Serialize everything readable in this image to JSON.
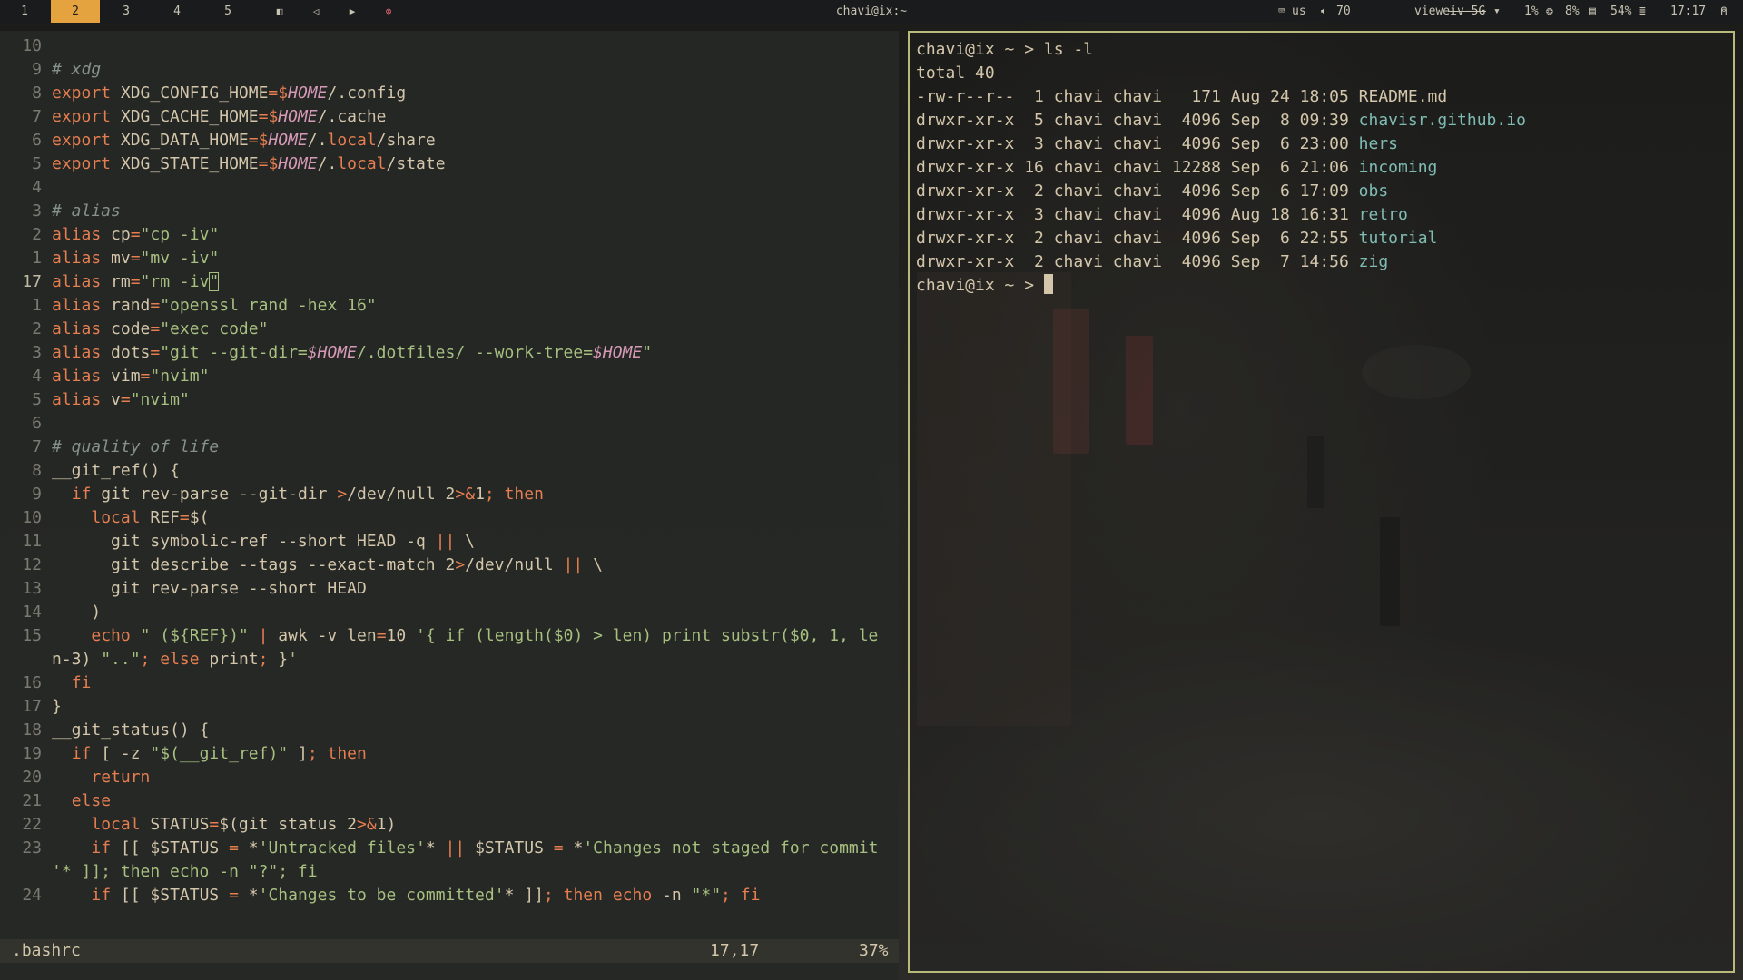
{
  "topbar": {
    "workspaces": [
      "1",
      "2",
      "3",
      "4",
      "5"
    ],
    "active_workspace": "2",
    "controls": [
      "◧",
      "◁",
      "▶",
      "⊗"
    ],
    "window_title": "chavi@ix:~",
    "keyboard_icon": "keyboard-icon",
    "keyboard_layout": "us",
    "volume_icon": "speaker-icon",
    "volume": "70",
    "wifi_name": "vieweiv-5G",
    "cpu": "1%",
    "cpu_icon": "cpu-icon",
    "mem": "8%",
    "mem_icon": "memory-icon",
    "disk": "54%",
    "disk_icon": "disk-icon",
    "clock": "17:17",
    "power_icon": "person-icon"
  },
  "editor": {
    "lines": [
      {
        "n": "10",
        "t": ""
      },
      {
        "n": "9",
        "t": "# xdg"
      },
      {
        "n": "8",
        "t": "export XDG_CONFIG_HOME=$HOME/.config"
      },
      {
        "n": "7",
        "t": "export XDG_CACHE_HOME=$HOME/.cache"
      },
      {
        "n": "6",
        "t": "export XDG_DATA_HOME=$HOME/.local/share"
      },
      {
        "n": "5",
        "t": "export XDG_STATE_HOME=$HOME/.local/state"
      },
      {
        "n": "4",
        "t": ""
      },
      {
        "n": "3",
        "t": "# alias"
      },
      {
        "n": "2",
        "t": "alias cp=\"cp -iv\""
      },
      {
        "n": "1",
        "t": "alias mv=\"mv -iv\""
      },
      {
        "n": "17",
        "t": "alias rm=\"rm -iv\""
      },
      {
        "n": "1",
        "t": "alias rand=\"openssl rand -hex 16\""
      },
      {
        "n": "2",
        "t": "alias code=\"exec code\""
      },
      {
        "n": "3",
        "t": "alias dots=\"git --git-dir=$HOME/.dotfiles/ --work-tree=$HOME\""
      },
      {
        "n": "4",
        "t": "alias vim=\"nvim\""
      },
      {
        "n": "5",
        "t": "alias v=\"nvim\""
      },
      {
        "n": "6",
        "t": ""
      },
      {
        "n": "7",
        "t": "# quality of life"
      },
      {
        "n": "8",
        "t": "__git_ref() {"
      },
      {
        "n": "9",
        "t": "  if git rev-parse --git-dir >/dev/null 2>&1; then"
      },
      {
        "n": "10",
        "t": "    local REF=$("
      },
      {
        "n": "11",
        "t": "      git symbolic-ref --short HEAD -q || \\"
      },
      {
        "n": "12",
        "t": "      git describe --tags --exact-match 2>/dev/null || \\"
      },
      {
        "n": "13",
        "t": "      git rev-parse --short HEAD"
      },
      {
        "n": "14",
        "t": "    )"
      },
      {
        "n": "15",
        "t": "    echo \" (${REF})\" | awk -v len=10 '{ if (length($0) > len) print substr($0, 1, le"
      },
      {
        "n": "",
        "t": "n-3) \"..\"; else print; }'"
      },
      {
        "n": "16",
        "t": "  fi"
      },
      {
        "n": "17",
        "t": "}"
      },
      {
        "n": "18",
        "t": "__git_status() {"
      },
      {
        "n": "19",
        "t": "  if [ -z \"$(__git_ref)\" ]; then"
      },
      {
        "n": "20",
        "t": "    return"
      },
      {
        "n": "21",
        "t": "  else"
      },
      {
        "n": "22",
        "t": "    local STATUS=$(git status 2>&1)"
      },
      {
        "n": "23",
        "t": "    if [[ $STATUS = *'Untracked files'* || $STATUS = *'Changes not staged for commit"
      },
      {
        "n": "",
        "t": "'* ]]; then echo -n \"?\"; fi"
      },
      {
        "n": "24",
        "t": "    if [[ $STATUS = *'Changes to be committed'* ]]; then echo -n \"*\"; fi"
      }
    ],
    "status": {
      "filename": ".bashrc",
      "position": "17,17",
      "percent": "37%"
    }
  },
  "terminal": {
    "prompt": "chavi@ix ~ >",
    "command": "ls -l",
    "total": "total 40",
    "entries": [
      {
        "perm": "-rw-r--r--",
        "links": "1",
        "user": "chavi",
        "group": "chavi",
        "size": "171",
        "date": "Aug 24 18:05",
        "name": "README.md",
        "is_dir": false
      },
      {
        "perm": "drwxr-xr-x",
        "links": "5",
        "user": "chavi",
        "group": "chavi",
        "size": "4096",
        "date": "Sep  8 09:39",
        "name": "chavisr.github.io",
        "is_dir": true
      },
      {
        "perm": "drwxr-xr-x",
        "links": "3",
        "user": "chavi",
        "group": "chavi",
        "size": "4096",
        "date": "Sep  6 23:00",
        "name": "hers",
        "is_dir": true
      },
      {
        "perm": "drwxr-xr-x",
        "links": "16",
        "user": "chavi",
        "group": "chavi",
        "size": "12288",
        "date": "Sep  6 21:06",
        "name": "incoming",
        "is_dir": true
      },
      {
        "perm": "drwxr-xr-x",
        "links": "2",
        "user": "chavi",
        "group": "chavi",
        "size": "4096",
        "date": "Sep  6 17:09",
        "name": "obs",
        "is_dir": true
      },
      {
        "perm": "drwxr-xr-x",
        "links": "3",
        "user": "chavi",
        "group": "chavi",
        "size": "4096",
        "date": "Aug 18 16:31",
        "name": "retro",
        "is_dir": true
      },
      {
        "perm": "drwxr-xr-x",
        "links": "2",
        "user": "chavi",
        "group": "chavi",
        "size": "4096",
        "date": "Sep  6 22:55",
        "name": "tutorial",
        "is_dir": true
      },
      {
        "perm": "drwxr-xr-x",
        "links": "2",
        "user": "chavi",
        "group": "chavi",
        "size": "4096",
        "date": "Sep  7 14:56",
        "name": "zig",
        "is_dir": true
      }
    ]
  },
  "colors": {
    "accent": "#e5a33f",
    "terminal_border": "#b8b97a",
    "directory": "#7fbbb3",
    "keyword": "#e67e50",
    "string": "#a7c080",
    "variable": "#d699b6",
    "comment": "#859289"
  }
}
